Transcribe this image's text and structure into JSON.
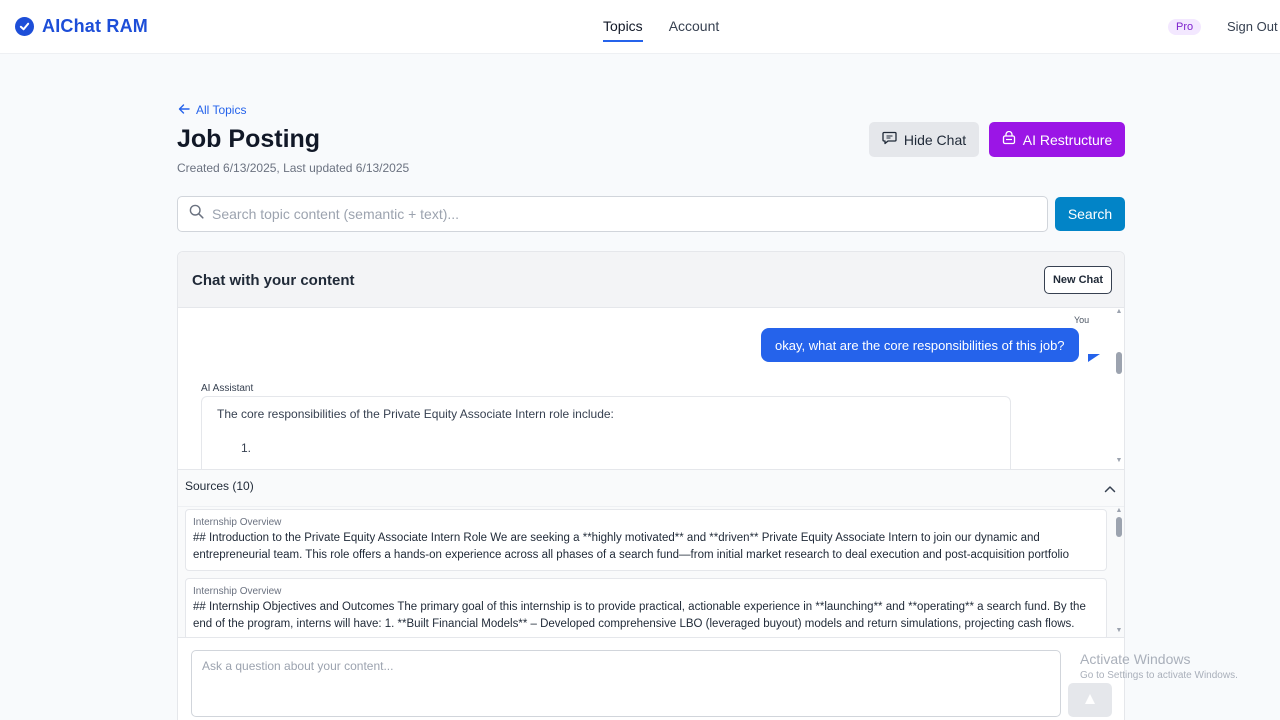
{
  "app": {
    "title": "AIChat RAM",
    "brand_color": "#1d4ed8"
  },
  "nav": {
    "items": [
      {
        "label": "Topics",
        "active": true
      },
      {
        "label": "Account",
        "active": false
      }
    ],
    "badge": "Pro",
    "signout": "Sign Out"
  },
  "page": {
    "back_link": "All Topics",
    "title": "Job Posting",
    "meta": "Created 6/13/2025, Last updated 6/13/2025",
    "hide_chat_label": "Hide Chat",
    "restructure_label": "AI Restructure"
  },
  "search": {
    "placeholder": "Search topic content (semantic + text)...",
    "button": "Search"
  },
  "chat": {
    "title": "Chat with your content",
    "new_chat_label": "New Chat",
    "messages": [
      {
        "sender": "You",
        "text": "okay, what are the core responsibilities of this job?"
      },
      {
        "sender": "AI Assistant",
        "text": "The core responsibilities of the Private Equity Associate Intern role include:",
        "list_start": "1."
      }
    ],
    "sources": {
      "title": "Sources (10)",
      "items": [
        {
          "label": "Internship Overview",
          "text": "## Introduction to the Private Equity Associate Intern Role We are seeking a **highly motivated** and **driven** Private Equity Associate Intern to join our dynamic and entrepreneurial team. This role offers a hands-on experience across all phases of a search fund—from initial market research to deal execution and post-acquisition portfolio management."
        },
        {
          "label": "Internship Overview",
          "text": "## Internship Objectives and Outcomes The primary goal of this internship is to provide practical, actionable experience in **launching** and **operating** a search fund. By the end of the program, interns will have: 1. **Built Financial Models** – Developed comprehensive LBO (leveraged buyout) models and return simulations, projecting cash flows."
        }
      ]
    },
    "input_placeholder": "Ask a question about your content..."
  },
  "watermark": {
    "title": "Activate Windows",
    "subtitle": "Go to Settings to activate Windows."
  },
  "colors": {
    "accent": "#2563eb",
    "restructure": "#9b15e6",
    "search_button": "#0284c7"
  }
}
